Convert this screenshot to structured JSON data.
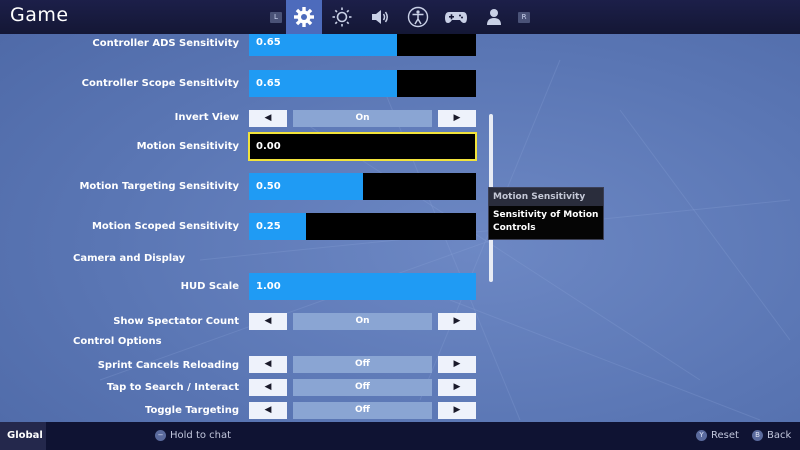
{
  "header": {
    "title": "Game",
    "left_bumper": "L",
    "right_bumper": "R",
    "tabs": [
      {
        "icon": "gear-icon",
        "active": true
      },
      {
        "icon": "brightness-icon",
        "active": false
      },
      {
        "icon": "speaker-icon",
        "active": false
      },
      {
        "icon": "accessibility-icon",
        "active": false
      },
      {
        "icon": "gamepad-icon",
        "active": false
      },
      {
        "icon": "person-icon",
        "active": false
      }
    ]
  },
  "settings": {
    "ads_sensitivity": {
      "label": "Controller ADS Sensitivity",
      "value_text": "0.65",
      "value": 0.65
    },
    "scope_sensitivity": {
      "label": "Controller Scope Sensitivity",
      "value_text": "0.65",
      "value": 0.65
    },
    "invert_view": {
      "label": "Invert View",
      "value": "On",
      "left": "◀",
      "right": "▶"
    },
    "motion_sensitivity": {
      "label": "Motion Sensitivity",
      "value_text": "0.00",
      "value": 0.0,
      "focused": true
    },
    "motion_targeting": {
      "label": "Motion Targeting Sensitivity",
      "value_text": "0.50",
      "value": 0.5
    },
    "motion_scoped": {
      "label": "Motion Scoped Sensitivity",
      "value_text": "0.25",
      "value": 0.25
    },
    "camera_section": "Camera and Display",
    "hud_scale": {
      "label": "HUD Scale",
      "value_text": "1.00",
      "value": 1.0
    },
    "spectator_count": {
      "label": "Show Spectator Count",
      "value": "On",
      "left": "◀",
      "right": "▶"
    },
    "control_section": "Control Options",
    "sprint_cancels": {
      "label": "Sprint Cancels Reloading",
      "value": "Off",
      "left": "◀",
      "right": "▶"
    },
    "tap_to_search": {
      "label": "Tap to Search / Interact",
      "value": "Off",
      "left": "◀",
      "right": "▶"
    },
    "toggle_targeting": {
      "label": "Toggle Targeting",
      "value": "Off",
      "left": "◀",
      "right": "▶"
    }
  },
  "tooltip": {
    "title": "Motion Sensitivity",
    "body": "Sensitivity of Motion Controls"
  },
  "footer": {
    "tab": "Global",
    "chat_glyph": "−",
    "chat_hint": "Hold to chat",
    "reset_glyph": "Y",
    "reset_label": "Reset",
    "back_glyph": "B",
    "back_label": "Back"
  },
  "colors": {
    "accent_blue": "#1f9bf4",
    "focus_yellow": "#f2e33b",
    "active_tab": "#4d6bbc"
  }
}
